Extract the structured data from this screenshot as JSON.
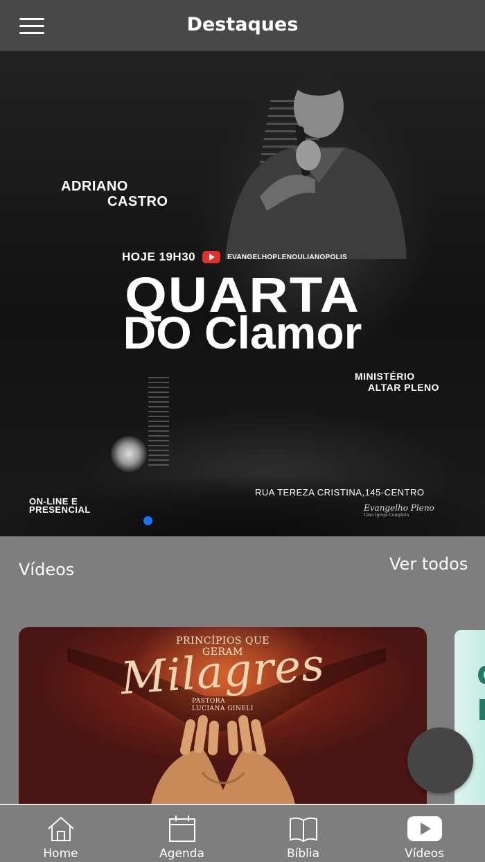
{
  "header": {
    "title": "Destaques"
  },
  "banner": {
    "speaker_line1": "ADRIANO",
    "speaker_line2": "CASTRO",
    "time": "HOJE 19H30",
    "channel": "EVANGELHOPLENOULIANOPOLIS",
    "title_line1": "QUARTA",
    "title_line2": "DO Clamor",
    "ministry_line1": "MINISTÉRIO",
    "ministry_line2": "ALTAR PLENO",
    "mode_line1": "ON-LINE E",
    "mode_line2": "PRESENCIAL",
    "address": "RUA TEREZA CRISTINA,145-CENTRO",
    "signature": "Evangelho Pleno",
    "signature_tagline": "Uma Igreja Completa",
    "carousel_active_index": 0,
    "accent_color": "#1576ff"
  },
  "videos": {
    "section_title": "Vídeos",
    "see_all_label": "Ver todos",
    "cards": [
      {
        "subtitle": "PRINCÍPIOS QUE\nGERAM",
        "script_title": "Milagres",
        "author": "PASTORA\nLUCIANA GINELI"
      }
    ]
  },
  "bottom_nav": {
    "items": [
      {
        "label": "Home",
        "icon": "home-icon"
      },
      {
        "label": "Agenda",
        "icon": "calendar-icon"
      },
      {
        "label": "Bíblia",
        "icon": "book-icon"
      },
      {
        "label": "Vídeos",
        "icon": "play-video-icon"
      }
    ]
  }
}
